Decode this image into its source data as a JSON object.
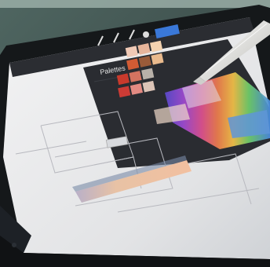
{
  "scene": {
    "subject": "tablet-drawing-app-photo",
    "palettes_panel": {
      "title": "Palettes"
    }
  },
  "colors": {
    "desk": "#3f504d",
    "tablet_frame": "#1a1d1f",
    "screen": "#e9e9ea",
    "panel": "#2a2c31",
    "accent_blue": "#3a78d8",
    "stylus": "#e6e6e3"
  },
  "palette_rows": [
    [
      "#f0c9b6",
      "#e7b59b",
      "#f3d2b0"
    ],
    [
      "#d25b34",
      "#9a5b39",
      "#e9ba8d"
    ],
    [
      "#c93a2c",
      "#d37360",
      "#b8b1a9"
    ],
    [
      "#cc3b35",
      "#e38a82",
      "#dcc4b7"
    ]
  ],
  "spectrum": [
    "#5b4bd0",
    "#a04bd3",
    "#e05191",
    "#f07e4e",
    "#f5c248",
    "#d7e44f",
    "#6fcf6b",
    "#45b7b2",
    "#4a8de2"
  ]
}
